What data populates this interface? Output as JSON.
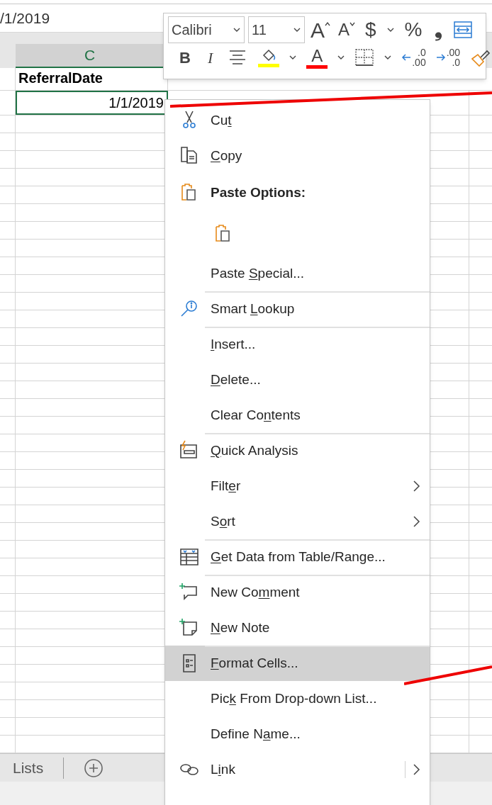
{
  "formula_bar": {
    "value": "/1/2019"
  },
  "column_headers": [
    {
      "label": "C",
      "selected": true
    }
  ],
  "header_row": [
    "ReferralDate"
  ],
  "selected_cell": {
    "value": "1/1/2019"
  },
  "mini_toolbar": {
    "font": "Calibri",
    "size": "11",
    "row_1": [
      {
        "kind": "grow",
        "glyph": "A"
      },
      {
        "kind": "shrink",
        "glyph": "A"
      },
      {
        "kind": "glyph",
        "glyph": "$"
      },
      {
        "kind": "chevron"
      },
      {
        "kind": "glyph",
        "glyph": "%"
      },
      {
        "kind": "comma",
        "glyph": "❟"
      },
      {
        "kind": "wrap"
      }
    ],
    "row_2": [
      {
        "kind": "bold",
        "glyph": "B"
      },
      {
        "kind": "italic",
        "glyph": "I"
      },
      {
        "kind": "align"
      },
      {
        "kind": "fill",
        "color": "#ffff00"
      },
      {
        "kind": "chevron"
      },
      {
        "kind": "fontcolor",
        "glyph": "A",
        "color": "#ff0000"
      },
      {
        "kind": "chevron"
      },
      {
        "kind": "borders"
      },
      {
        "kind": "chevron"
      },
      {
        "kind": "decimal",
        "lines": [
          ".0",
          ".00"
        ]
      },
      {
        "kind": "decimal",
        "lines": [
          ".00",
          ".0"
        ]
      },
      {
        "kind": "painter"
      }
    ]
  },
  "context_menu": [
    {
      "kind": "item",
      "label": {
        "before": "Cu",
        "key": "t"
      },
      "submenu": false,
      "divider_before": false,
      "selected": false
    },
    {
      "kind": "item",
      "label": {
        "key": "C",
        "after": "opy"
      },
      "submenu": false,
      "divider_before": false,
      "selected": false
    },
    {
      "kind": "heading",
      "label": {
        "before": "Paste Options:"
      }
    },
    {
      "kind": "paste-icons"
    },
    {
      "kind": "item",
      "label": {
        "before": "Paste ",
        "key": "S",
        "after": "pecial..."
      },
      "submenu": false,
      "divider_before": false,
      "selected": false
    },
    {
      "kind": "item",
      "label": {
        "before": "Smart ",
        "key": "L",
        "after": "ookup"
      },
      "submenu": false,
      "divider_before": true,
      "selected": false
    },
    {
      "kind": "item",
      "label": {
        "key": "I",
        "after": "nsert..."
      },
      "submenu": false,
      "divider_before": true,
      "selected": false
    },
    {
      "kind": "item",
      "label": {
        "key": "D",
        "after": "elete..."
      },
      "submenu": false,
      "divider_before": false,
      "selected": false
    },
    {
      "kind": "item",
      "label": {
        "before": "Clear Co",
        "key": "n",
        "after": "tents"
      },
      "submenu": false,
      "divider_before": false,
      "selected": false
    },
    {
      "kind": "item",
      "label": {
        "key": "Q",
        "after": "uick Analysis"
      },
      "submenu": false,
      "divider_before": true,
      "selected": false
    },
    {
      "kind": "item",
      "label": {
        "before": "Filt",
        "key": "e",
        "after": "r"
      },
      "submenu": true,
      "divider_before": false,
      "selected": false
    },
    {
      "kind": "item",
      "label": {
        "before": "S",
        "key": "o",
        "after": "rt"
      },
      "submenu": true,
      "divider_before": false,
      "selected": false
    },
    {
      "kind": "item",
      "label": {
        "key": "G",
        "after": "et Data from Table/Range..."
      },
      "submenu": false,
      "divider_before": true,
      "selected": false
    },
    {
      "kind": "item",
      "label": {
        "before": "New Co",
        "key": "m",
        "after": "ment"
      },
      "submenu": false,
      "divider_before": true,
      "selected": false
    },
    {
      "kind": "item",
      "label": {
        "key": "N",
        "after": "ew Note"
      },
      "submenu": false,
      "divider_before": false,
      "selected": false
    },
    {
      "kind": "item",
      "label": {
        "key": "F",
        "after": "ormat Cells..."
      },
      "submenu": false,
      "divider_before": true,
      "selected": true
    },
    {
      "kind": "item",
      "label": {
        "before": "Pic",
        "key": "k",
        "after": " From Drop-down List..."
      },
      "submenu": false,
      "divider_before": false,
      "selected": false
    },
    {
      "kind": "item",
      "label": {
        "before": "Define N",
        "key": "a",
        "after": "me..."
      },
      "submenu": false,
      "divider_before": false,
      "selected": false
    },
    {
      "kind": "split",
      "label": {
        "before": "L",
        "key": "i",
        "after": "nk"
      },
      "submenu": true,
      "divider_before": false,
      "selected": false
    }
  ],
  "sheet_tabs": [
    {
      "label": "Lists"
    }
  ]
}
